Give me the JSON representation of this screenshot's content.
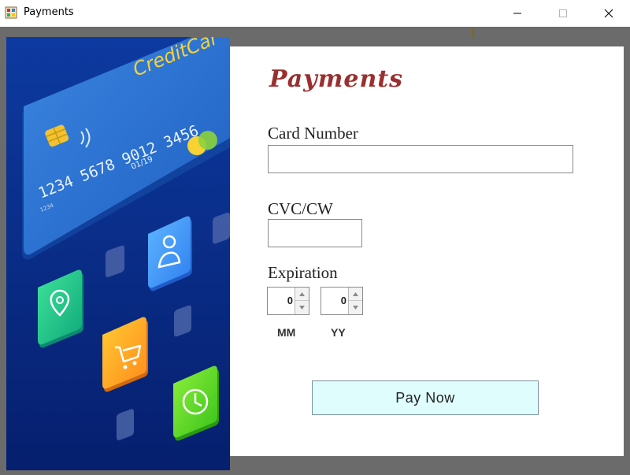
{
  "window": {
    "title": "Payments",
    "controls": [
      "minimize",
      "maximize",
      "close"
    ]
  },
  "illustration": {
    "card_brand": "CreditCar",
    "card_number": "1234 5678 9012 3456",
    "card_expiry": "01/19",
    "card_small": "1234",
    "icons": [
      "location-icon",
      "user-icon",
      "cart-icon",
      "clock-icon"
    ]
  },
  "form": {
    "heading": "Payments",
    "card_number_label": "Card Number",
    "card_number_value": "",
    "cvc_label": "CVC/CW",
    "cvc_value": "",
    "expiration_label": "Expiration",
    "month_value": "0",
    "year_value": "0",
    "month_unit": "MM",
    "year_unit": "YY",
    "pay_button_label": "Pay Now"
  },
  "colors": {
    "heading": "#9b2f2f",
    "pay_button_bg": "#e0fdfd",
    "frame": "#6b6b6b",
    "art_background": "#0a2b86"
  }
}
